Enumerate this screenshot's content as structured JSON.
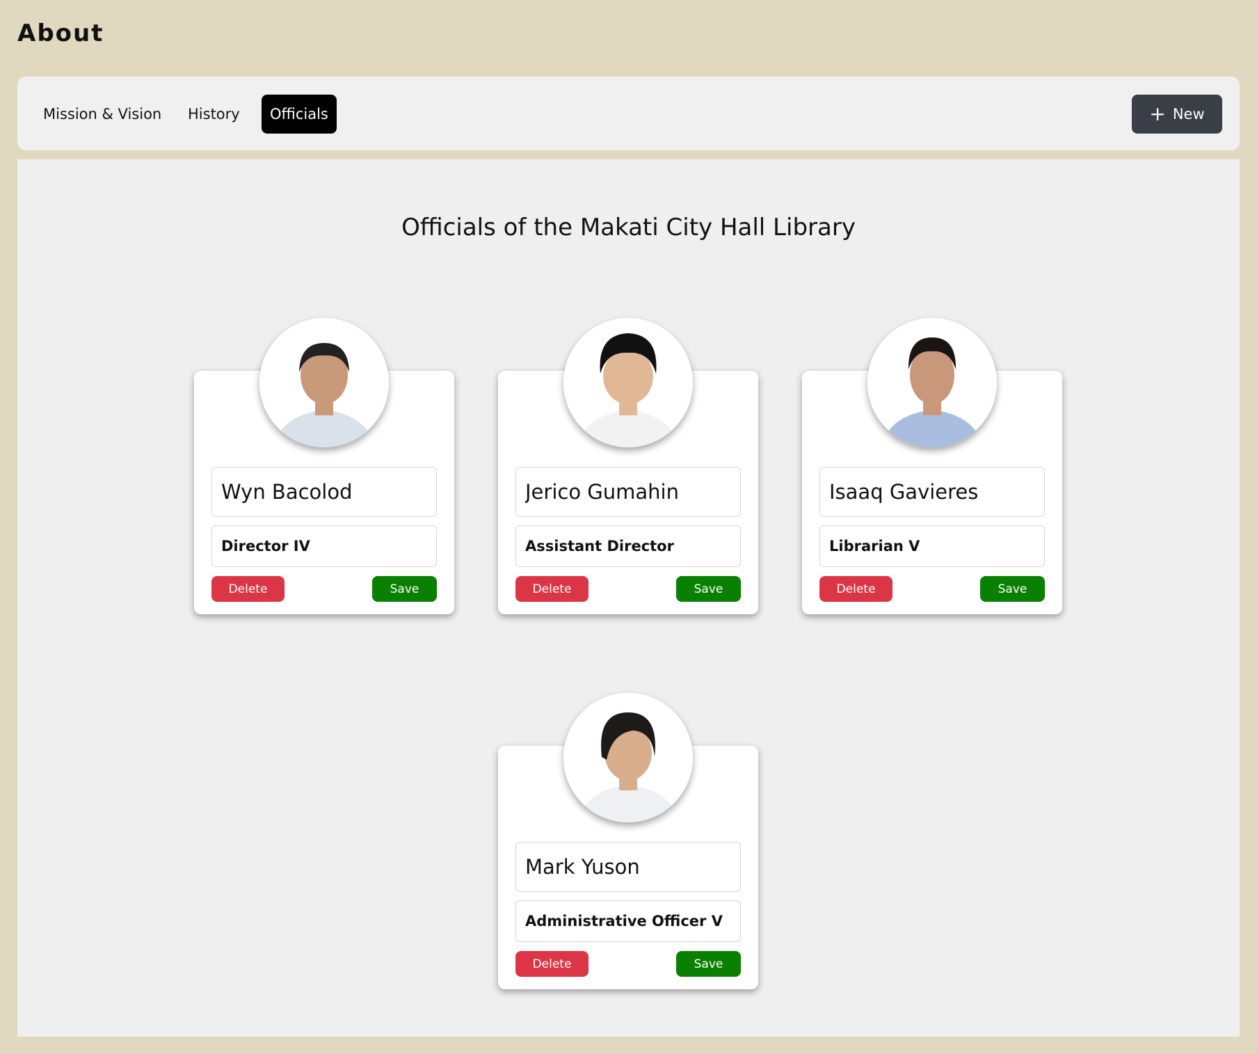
{
  "page": {
    "title": "About"
  },
  "tabs": [
    {
      "label": "Mission & Vision",
      "active": false
    },
    {
      "label": "History",
      "active": false
    },
    {
      "label": "Officials",
      "active": true
    }
  ],
  "toolbar": {
    "new_label": "New",
    "new_icon": "plus-icon"
  },
  "section": {
    "heading": "Officials of the Makati City Hall Library"
  },
  "officials": [
    {
      "name": "Wyn Bacolod",
      "position": "Director IV",
      "shirt": "#d9e1ea",
      "hair": "#222",
      "skin": "#c89a7a"
    },
    {
      "name": "Jerico Gumahin",
      "position": "Assistant Director",
      "shirt": "#f2f2f2",
      "hair": "#111",
      "skin": "#e0b896"
    },
    {
      "name": "Isaaq Gavieres",
      "position": "Librarian V",
      "shirt": "#a9bde0",
      "hair": "#1a1412",
      "skin": "#c9987a"
    },
    {
      "name": "Mark Yuson",
      "position": "Administrative Officer V",
      "shirt": "#eef0f4",
      "hair": "#1e1a18",
      "skin": "#d8ad8c"
    }
  ],
  "actions": {
    "delete_label": "Delete",
    "save_label": "Save"
  },
  "colors": {
    "background": "#e0d8bf",
    "delete": "#dc3545",
    "save": "#0a8000",
    "new_button": "#3a3f47"
  }
}
